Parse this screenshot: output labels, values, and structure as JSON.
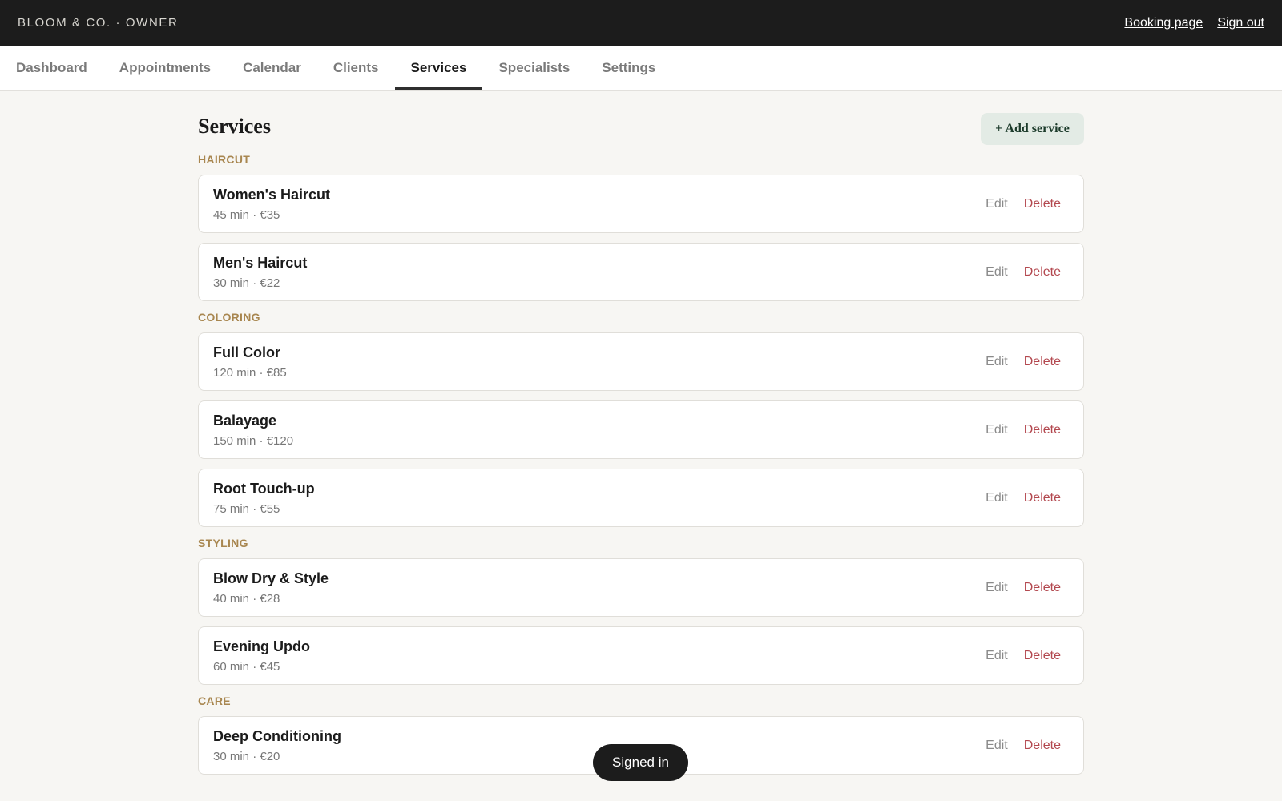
{
  "header": {
    "brand": "BLOOM & CO. · OWNER",
    "links": [
      "Booking page",
      "Sign out"
    ]
  },
  "tabs": [
    {
      "label": "Dashboard",
      "active": false
    },
    {
      "label": "Appointments",
      "active": false
    },
    {
      "label": "Calendar",
      "active": false
    },
    {
      "label": "Clients",
      "active": false
    },
    {
      "label": "Services",
      "active": true
    },
    {
      "label": "Specialists",
      "active": false
    },
    {
      "label": "Settings",
      "active": false
    }
  ],
  "page": {
    "title": "Services",
    "add_button": "+ Add service"
  },
  "actions": {
    "edit": "Edit",
    "delete": "Delete"
  },
  "categories": [
    {
      "name": "HAIRCUT",
      "services": [
        {
          "name": "Women's Haircut",
          "duration": "45 min",
          "price": "€35"
        },
        {
          "name": "Men's Haircut",
          "duration": "30 min",
          "price": "€22"
        }
      ]
    },
    {
      "name": "COLORING",
      "services": [
        {
          "name": "Full Color",
          "duration": "120 min",
          "price": "€85"
        },
        {
          "name": "Balayage",
          "duration": "150 min",
          "price": "€120"
        },
        {
          "name": "Root Touch-up",
          "duration": "75 min",
          "price": "€55"
        }
      ]
    },
    {
      "name": "STYLING",
      "services": [
        {
          "name": "Blow Dry & Style",
          "duration": "40 min",
          "price": "€28"
        },
        {
          "name": "Evening Updo",
          "duration": "60 min",
          "price": "€45"
        }
      ]
    },
    {
      "name": "CARE",
      "services": [
        {
          "name": "Deep Conditioning",
          "duration": "30 min",
          "price": "€20"
        }
      ]
    }
  ],
  "toast": "Signed in",
  "colors": {
    "topbar": "#1c1c1c",
    "category": "#a8864f",
    "delete": "#b3484f",
    "add_button_bg": "#e3ebe5"
  }
}
